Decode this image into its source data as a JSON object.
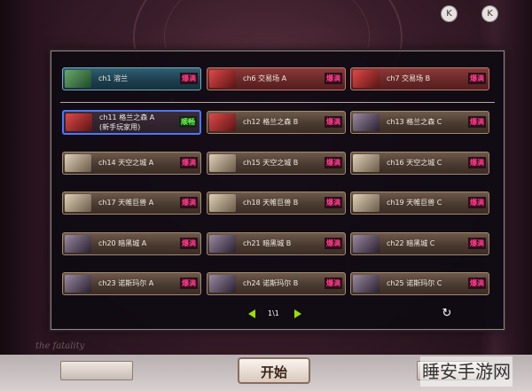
{
  "servers": [
    {
      "label": "ch1 溶兰",
      "status": "爆满"
    },
    {
      "label": "ch6 交易场 A",
      "status": "爆满"
    },
    {
      "label": "ch7 交易场 B",
      "status": "爆满"
    },
    {
      "label": "ch11 格兰之森 A",
      "label2": "(新手玩家用)",
      "status": "顺畅"
    },
    {
      "label": "ch12 格兰之森 B",
      "status": "爆满"
    },
    {
      "label": "ch13 格兰之森 C",
      "status": "爆满"
    },
    {
      "label": "ch14 天空之城 A",
      "status": "爆满"
    },
    {
      "label": "ch15 天空之城 B",
      "status": "爆满"
    },
    {
      "label": "ch16 天空之城 C",
      "status": "爆满"
    },
    {
      "label": "ch17 天帷巨兽 A",
      "status": "爆满"
    },
    {
      "label": "ch18 天帷巨兽 B",
      "status": "爆满"
    },
    {
      "label": "ch19 天帷巨兽 C",
      "status": "爆满"
    },
    {
      "label": "ch20 暗黑城 A",
      "status": "爆满"
    },
    {
      "label": "ch21 暗黑城 B",
      "status": "爆满"
    },
    {
      "label": "ch22 暗黑城 C",
      "status": "爆满"
    },
    {
      "label": "ch23 诺斯玛尔 A",
      "status": "爆满"
    },
    {
      "label": "ch24 诺斯玛尔 B",
      "status": "爆满"
    },
    {
      "label": "ch25 诺斯玛尔 C",
      "status": "爆满"
    }
  ],
  "pagination": {
    "page": "1\\1"
  },
  "icons": {
    "refresh": "refresh-icon",
    "prev": "arrow-left-icon",
    "next": "arrow-right-icon"
  },
  "colors": {
    "full": "#ff3a8a",
    "smooth": "#6aff4a",
    "selected": "#4a78ff",
    "pager_arrow": "#9ae000"
  },
  "start_button": "开始",
  "background_text": "the fatality",
  "watermark": "睡安手游网"
}
